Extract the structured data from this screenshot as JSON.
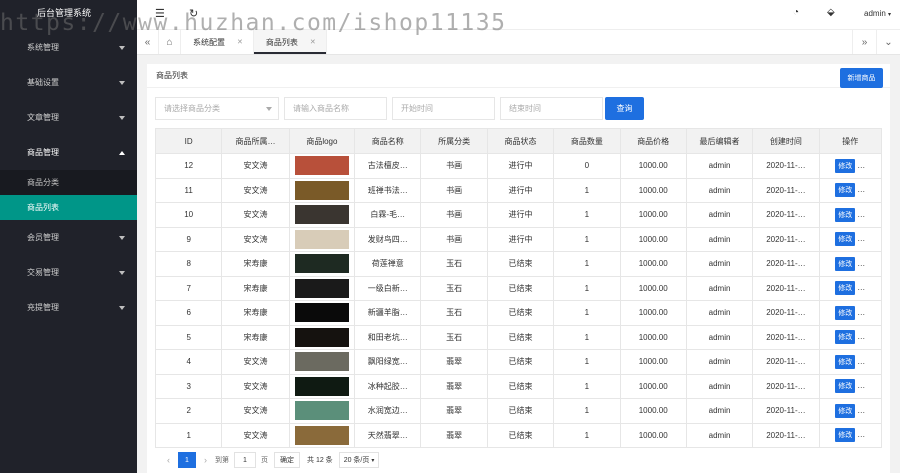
{
  "brand": "后台管理系统",
  "watermark": "https://www.huzhan.com/ishop11135",
  "sidebar": {
    "items": [
      {
        "label": "系统管理"
      },
      {
        "label": "基础设置"
      },
      {
        "label": "文章管理"
      },
      {
        "label": "商品管理",
        "open": true
      },
      {
        "label": "会员管理"
      },
      {
        "label": "交易管理"
      },
      {
        "label": "充提管理"
      }
    ],
    "sub_items": [
      {
        "label": "商品分类",
        "active": false
      },
      {
        "label": "商品列表",
        "active": true
      }
    ]
  },
  "topbar": {
    "user": "admin",
    "icons": [
      "menu-icon",
      "refresh-icon",
      "theme-icon",
      "tag-icon"
    ]
  },
  "tabs": [
    {
      "label": "系统配置",
      "active": false
    },
    {
      "label": "商品列表",
      "active": true
    }
  ],
  "card": {
    "title": "商品列表",
    "add_button": "新增商品"
  },
  "filters": {
    "category_placeholder": "请选择商品分类",
    "name_placeholder": "请输入商品名称",
    "start_placeholder": "开始时间",
    "end_placeholder": "结束时间",
    "search_button": "查询"
  },
  "table": {
    "headers": [
      "ID",
      "商品所属…",
      "商品logo",
      "商品名称",
      "所属分类",
      "商品状态",
      "商品数量",
      "商品价格",
      "最后编辑者",
      "创建时间",
      "操作"
    ],
    "edit_label": "修改",
    "more_label": "…",
    "rows": [
      {
        "id": "12",
        "owner": "安文涛",
        "logo_color": "#b8503a",
        "name": "古法檀皮…",
        "category": "书画",
        "status": "进行中",
        "qty": "0",
        "price": "1000.00",
        "editor": "admin",
        "created": "2020-11-…"
      },
      {
        "id": "11",
        "owner": "安文涛",
        "logo_color": "#7a5a28",
        "name": "班禅书法…",
        "category": "书画",
        "status": "进行中",
        "qty": "1",
        "price": "1000.00",
        "editor": "admin",
        "created": "2020-11-…"
      },
      {
        "id": "10",
        "owner": "安文涛",
        "logo_color": "#3a3530",
        "name": "白霖-毛…",
        "category": "书画",
        "status": "进行中",
        "qty": "1",
        "price": "1000.00",
        "editor": "admin",
        "created": "2020-11-…"
      },
      {
        "id": "9",
        "owner": "安文涛",
        "logo_color": "#d8ccb8",
        "name": "发财鸟四…",
        "category": "书画",
        "status": "进行中",
        "qty": "1",
        "price": "1000.00",
        "editor": "admin",
        "created": "2020-11-…"
      },
      {
        "id": "8",
        "owner": "宋寿康",
        "logo_color": "#1e2a22",
        "name": "荷莲禅意",
        "category": "玉石",
        "status": "已结束",
        "qty": "1",
        "price": "1000.00",
        "editor": "admin",
        "created": "2020-11-…"
      },
      {
        "id": "7",
        "owner": "宋寿康",
        "logo_color": "#1a1a1a",
        "name": "一级白新…",
        "category": "玉石",
        "status": "已结束",
        "qty": "1",
        "price": "1000.00",
        "editor": "admin",
        "created": "2020-11-…"
      },
      {
        "id": "6",
        "owner": "宋寿康",
        "logo_color": "#0a0a0a",
        "name": "新疆羊脂…",
        "category": "玉石",
        "status": "已结束",
        "qty": "1",
        "price": "1000.00",
        "editor": "admin",
        "created": "2020-11-…"
      },
      {
        "id": "5",
        "owner": "宋寿康",
        "logo_color": "#15120f",
        "name": "和田老坑…",
        "category": "玉石",
        "status": "已结束",
        "qty": "1",
        "price": "1000.00",
        "editor": "admin",
        "created": "2020-11-…"
      },
      {
        "id": "4",
        "owner": "安文涛",
        "logo_color": "#6b6a60",
        "name": "飘阳绿宽…",
        "category": "翡翠",
        "status": "已结束",
        "qty": "1",
        "price": "1000.00",
        "editor": "admin",
        "created": "2020-11-…"
      },
      {
        "id": "3",
        "owner": "安文涛",
        "logo_color": "#0f1a12",
        "name": "冰种起胶…",
        "category": "翡翠",
        "status": "已结束",
        "qty": "1",
        "price": "1000.00",
        "editor": "admin",
        "created": "2020-11-…"
      },
      {
        "id": "2",
        "owner": "安文涛",
        "logo_color": "#5b8f7a",
        "name": "水润宽边…",
        "category": "翡翠",
        "status": "已结束",
        "qty": "1",
        "price": "1000.00",
        "editor": "admin",
        "created": "2020-11-…"
      },
      {
        "id": "1",
        "owner": "安文涛",
        "logo_color": "#8a6a3a",
        "name": "天然翡翠…",
        "category": "翡翠",
        "status": "已结束",
        "qty": "1",
        "price": "1000.00",
        "editor": "admin",
        "created": "2020-11-…"
      }
    ]
  },
  "pager": {
    "current": "1",
    "goto_label": "到第",
    "goto_value": "1",
    "page_label": "页",
    "confirm": "确定",
    "total": "共 12 条",
    "size": "20 条/页"
  },
  "colors": {
    "primary": "#1e6fe0",
    "active_menu": "#009688",
    "sidebar": "#20222a"
  }
}
